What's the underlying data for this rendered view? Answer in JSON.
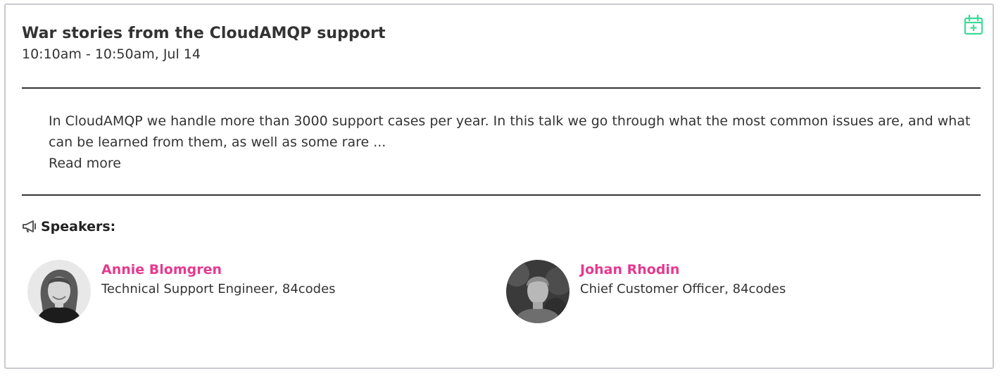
{
  "session": {
    "title": "War stories from the CloudAMQP support",
    "time": "10:10am - 10:50am, Jul 14",
    "description": "In CloudAMQP we handle more than 3000 support cases per year. In this talk we go through what the most common issues are, and what can be learned from them, as well as some rare ...",
    "read_more": "Read more"
  },
  "calendar_icon": {
    "name": "calendar-add-icon",
    "color": "#3ddc97"
  },
  "speakers": {
    "heading": "Speakers:",
    "icon": "megaphone-icon",
    "items": [
      {
        "name": "Annie Blomgren",
        "role": "Technical Support Engineer, 84codes"
      },
      {
        "name": "Johan Rhodin",
        "role": "Chief Customer Officer, 84codes"
      }
    ]
  },
  "colors": {
    "speaker_name": "#e6398f",
    "text": "#333333",
    "border": "#c9c9d1"
  }
}
